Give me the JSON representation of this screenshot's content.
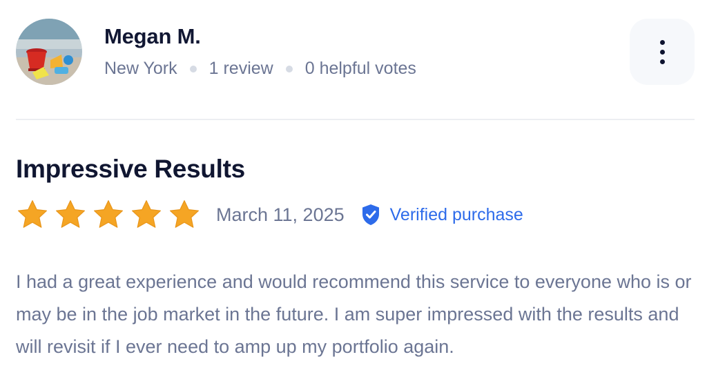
{
  "reviewer": {
    "name": "Megan M.",
    "location": "New York",
    "review_count": "1 review",
    "helpful_votes": "0 helpful votes",
    "avatar_icon": "beach-toys-avatar"
  },
  "menu": {
    "icon": "more-vertical-icon"
  },
  "review": {
    "title": "Impressive Results",
    "rating": 5,
    "max_rating": 5,
    "date": "March 11, 2025",
    "verified_label": "Verified purchase",
    "text": "I had a great experience and would recommend this service to everyone who is or may be in the job market in the future. I am super impressed with the results and will revisit if I ever need to amp up my portfolio again."
  },
  "colors": {
    "star": "#f5a524",
    "verified": "#2d6bea",
    "name": "#111733",
    "muted": "#6b7593"
  }
}
